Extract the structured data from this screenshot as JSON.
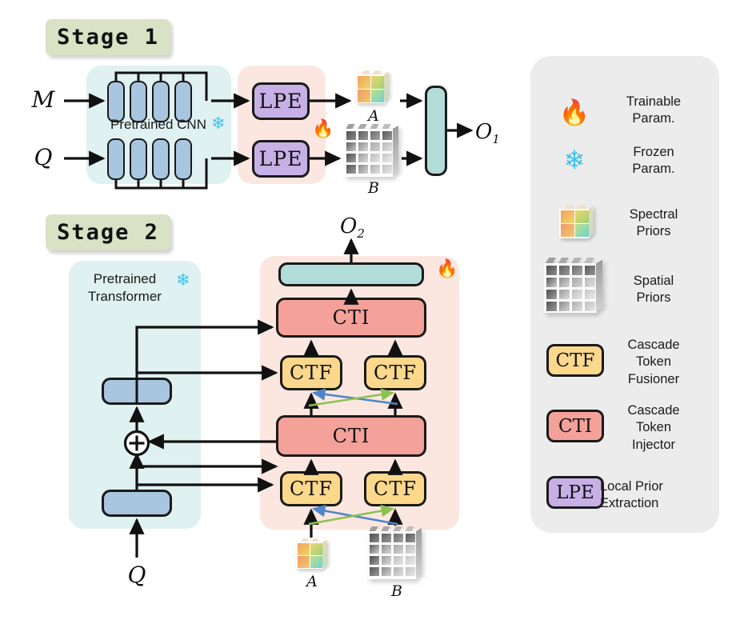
{
  "figure": {
    "type": "architecture-diagram",
    "title": "Two-stage spectral/spatial prior network"
  },
  "stage1": {
    "badge": "Stage 1",
    "inputs": [
      {
        "symbol": "M",
        "name": "mask-input"
      },
      {
        "symbol": "Q",
        "name": "query-input"
      }
    ],
    "backbone_label": "Pretrained CNN",
    "backbone_state_icon": "snowflake-icon",
    "lpe_blocks": [
      {
        "label": "LPE"
      },
      {
        "label": "LPE"
      }
    ],
    "trainable_icon": "fire-icon",
    "priors": [
      {
        "symbol": "A",
        "kind": "spectral"
      },
      {
        "symbol": "B",
        "kind": "spatial"
      }
    ],
    "fusion_bar": {
      "label": ""
    },
    "output": {
      "symbol": "O",
      "subscript": "1"
    }
  },
  "stage2": {
    "badge": "Stage 2",
    "backbone_label_line1": "Pretrained",
    "backbone_label_line2": "Transformer",
    "backbone_state_icon": "snowflake-icon",
    "trainable_icon": "fire-icon",
    "input": {
      "symbol": "Q"
    },
    "add_node": "plus-circle-icon",
    "transformer_blocks": [
      {
        "label": ""
      },
      {
        "label": ""
      }
    ],
    "ctf_blocks": [
      {
        "label": "CTF"
      },
      {
        "label": "CTF"
      },
      {
        "label": "CTF"
      },
      {
        "label": "CTF"
      }
    ],
    "cti_blocks": [
      {
        "label": "CTI"
      },
      {
        "label": "CTI"
      }
    ],
    "head_bar": {
      "label": ""
    },
    "priors": [
      {
        "symbol": "A",
        "kind": "spectral"
      },
      {
        "symbol": "B",
        "kind": "spatial"
      }
    ],
    "output": {
      "symbol": "O",
      "subscript": "2"
    }
  },
  "legend": {
    "items": [
      {
        "icon": "fire-icon",
        "line1": "Trainable",
        "line2": "Param.",
        "line3": "",
        "chip": ""
      },
      {
        "icon": "snowflake-icon",
        "line1": "Frozen",
        "line2": "Param.",
        "line3": "",
        "chip": ""
      },
      {
        "icon": "spectral-cube-icon",
        "line1": "Spectral",
        "line2": "Priors",
        "line3": "",
        "chip": ""
      },
      {
        "icon": "spatial-grid-icon",
        "line1": "Spatial",
        "line2": "Priors",
        "line3": "",
        "chip": ""
      },
      {
        "icon": "ctf-chip-icon",
        "line1": "Cascade",
        "line2": "Token",
        "line3": "Fusioner",
        "chip": "CTF"
      },
      {
        "icon": "cti-chip-icon",
        "line1": "Cascade",
        "line2": "Token",
        "line3": "Injector",
        "chip": "CTI"
      },
      {
        "icon": "lpe-chip-icon",
        "line1": "Local Prior",
        "line2": "Extraction",
        "line3": "",
        "chip": "LPE"
      }
    ]
  },
  "colors": {
    "badge_green": "#d9e2c4",
    "panel_teal": "#dff1f0",
    "panel_pink": "#fce7e0",
    "lpe_purple": "#c7b0e6",
    "ctf_yellow": "#fbd88b",
    "cti_red": "#f4a199",
    "teal_bar": "#b2dcd8",
    "blue_block": "#a8c6df",
    "legend_bg": "#ececec",
    "arrow_black": "#111111",
    "arrow_blue": "#4d86c9",
    "arrow_green": "#8cc152",
    "fire": "#f2833a",
    "snow": "#3ec2f0"
  }
}
